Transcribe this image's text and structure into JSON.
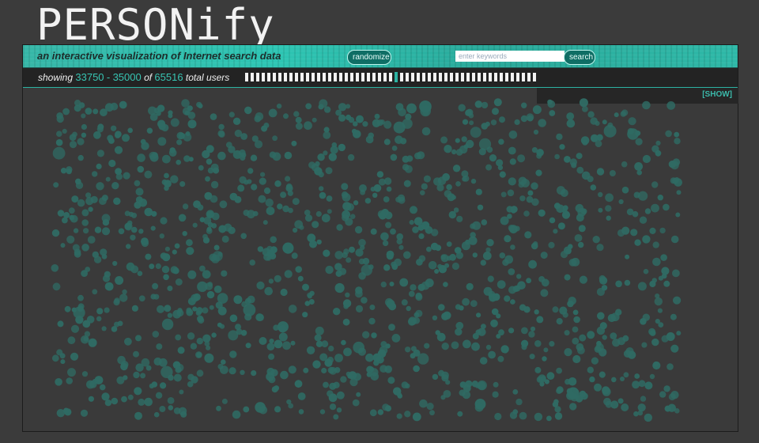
{
  "app": {
    "logo": "PERSONify",
    "tagline": "an interactive visualization of Internet search data"
  },
  "header": {
    "randomize_label": "randomize",
    "search_placeholder": "enter keywords",
    "search_value": "",
    "search_label": "search"
  },
  "status": {
    "showing_label": "showing",
    "range_start": "33750",
    "range_sep": "-",
    "range_end": "35000",
    "of_label": "of",
    "total": "65516",
    "total_label": "total users"
  },
  "pager": {
    "segments": 53,
    "active_segment": 27
  },
  "panel": {
    "show_label": "[SHOW]"
  },
  "colors": {
    "accent": "#2cb3a3",
    "dot": "#2f6a63",
    "background": "#3b3b3b"
  }
}
